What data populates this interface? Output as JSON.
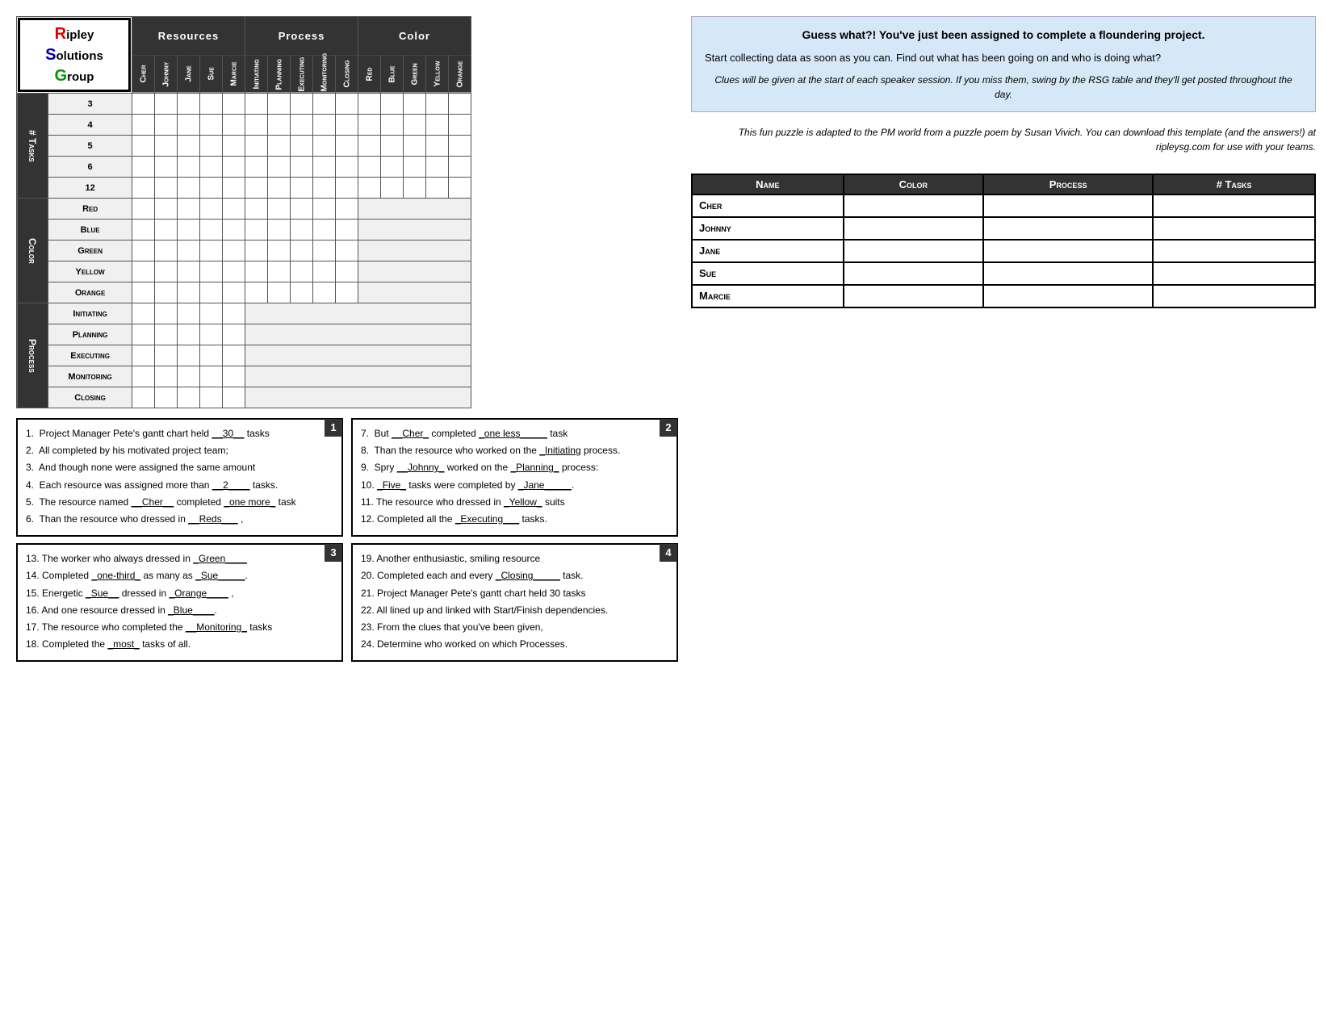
{
  "logo": {
    "r": "R",
    "ripley": "ipley",
    "s": "S",
    "olutions": "olutions",
    "g": "G",
    "roup": "roup"
  },
  "headers": {
    "resources": "Resources",
    "process": "Process",
    "color": "Color"
  },
  "col_headers": [
    "Cher",
    "Johnny",
    "Jane",
    "Sue",
    "Marcie",
    "Initiating",
    "Planning",
    "Executing",
    "Monitoring",
    "Closing",
    "Red",
    "Blue",
    "Green",
    "Yellow",
    "Orange"
  ],
  "row_sections": {
    "tasks": "# Tasks",
    "color": "Color",
    "process": "Process"
  },
  "row_labels": {
    "tasks": [
      "3",
      "4",
      "5",
      "6",
      "12"
    ],
    "color": [
      "Red",
      "Blue",
      "Green",
      "Yellow",
      "Orange"
    ],
    "process": [
      "Initiating",
      "Planning",
      "Executing",
      "Monitoring",
      "Closing"
    ]
  },
  "info_box": {
    "headline": "Guess what?! You've just been assigned to complete a floundering project.",
    "body": "Start collecting data as soon as you can.  Find out what has been going on and who is doing what?",
    "italic_note": "Clues will be given at the start of each speaker session.  If you miss them, swing by the RSG table and they'll get posted throughout the day."
  },
  "italic_para": "This fun puzzle is adapted to the PM world from a puzzle poem by Susan Vivich.  You can download this template (and the answers!) at ripleysg.com for use with your teams.",
  "summary_table": {
    "headers": [
      "Name",
      "Color",
      "Process",
      "# Tasks"
    ],
    "rows": [
      {
        "name": "Cher",
        "color": "",
        "process": "",
        "tasks": ""
      },
      {
        "name": "Johnny",
        "color": "",
        "process": "",
        "tasks": ""
      },
      {
        "name": "Jane",
        "color": "",
        "process": "",
        "tasks": ""
      },
      {
        "name": "Sue",
        "color": "",
        "process": "",
        "tasks": ""
      },
      {
        "name": "Marcie",
        "color": "",
        "process": "",
        "tasks": ""
      }
    ]
  },
  "clue_boxes": [
    {
      "number": "1",
      "lines": [
        "1.  Project Manager Pete's gantt chart held <u>__30__</u> tasks",
        "2.  All completed by his motivated project team;",
        "3.  And though none were assigned the same amount",
        "4.  Each resource was assigned more than <u>__2____</u> tasks.",
        "5.  The resource named <u>__Cher__</u> completed <u>_one more_</u> task",
        "6.  Than the resource who dressed in <u>__Reds___</u> ,"
      ]
    },
    {
      "number": "2",
      "lines": [
        "7.  But <u>__Cher_</u> completed <u>_one less_____</u> task",
        "8.  Than the resource who worked on the <u>_Initiating</u> process.",
        "9.  Spry <u>__Johnny_</u> worked on the <u>_Planning_</u> process:",
        "10. <u>_Five_</u> tasks were completed by <u>_Jane_____</u>.",
        "11. The resource who dressed in <u>_Yellow_</u> suits",
        "12. Completed all the <u>_Executing___</u> tasks."
      ]
    },
    {
      "number": "3",
      "lines": [
        "13. The worker who always dressed in <u>_Green____</u>",
        "14. Completed <u>_one-third_</u> as many as <u>_Sue_____</u>.",
        "15. Energetic <u>_Sue__</u> dressed in <u>_Orange____</u> ,",
        "16. And one resource dressed in <u>_Blue____</u>.",
        "17. The resource who completed the <u>__Monitoring_</u> tasks",
        "18. Completed the <u>_most_</u> tasks of all."
      ]
    },
    {
      "number": "4",
      "lines": [
        "19. Another enthusiastic, smiling resource",
        "20. Completed each and every <u>_Closing_____</u> task.",
        "21. Project Manager Pete's gantt chart held 30 tasks",
        "22. All lined up and linked with Start/Finish dependencies.",
        "23. From the clues that you've been given,",
        "24. Determine who worked on which Processes."
      ]
    }
  ]
}
